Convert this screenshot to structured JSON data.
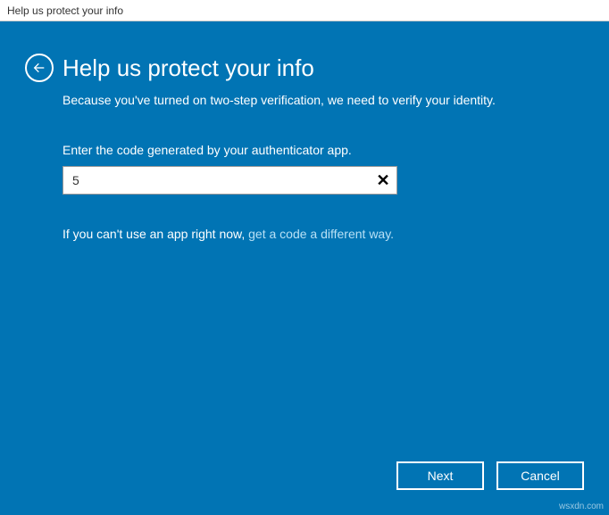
{
  "window": {
    "title": "Help us protect your info"
  },
  "page": {
    "heading": "Help us protect your info",
    "subtitle": "Because you've turned on two-step verification, we need to verify your identity.",
    "input_label": "Enter the code generated by your authenticator app.",
    "code_value": "5",
    "help_prefix": "If you can't use an app right now, ",
    "help_link": "get a code a different way.",
    "next_label": "Next",
    "cancel_label": "Cancel"
  },
  "watermark": "wsxdn.com"
}
